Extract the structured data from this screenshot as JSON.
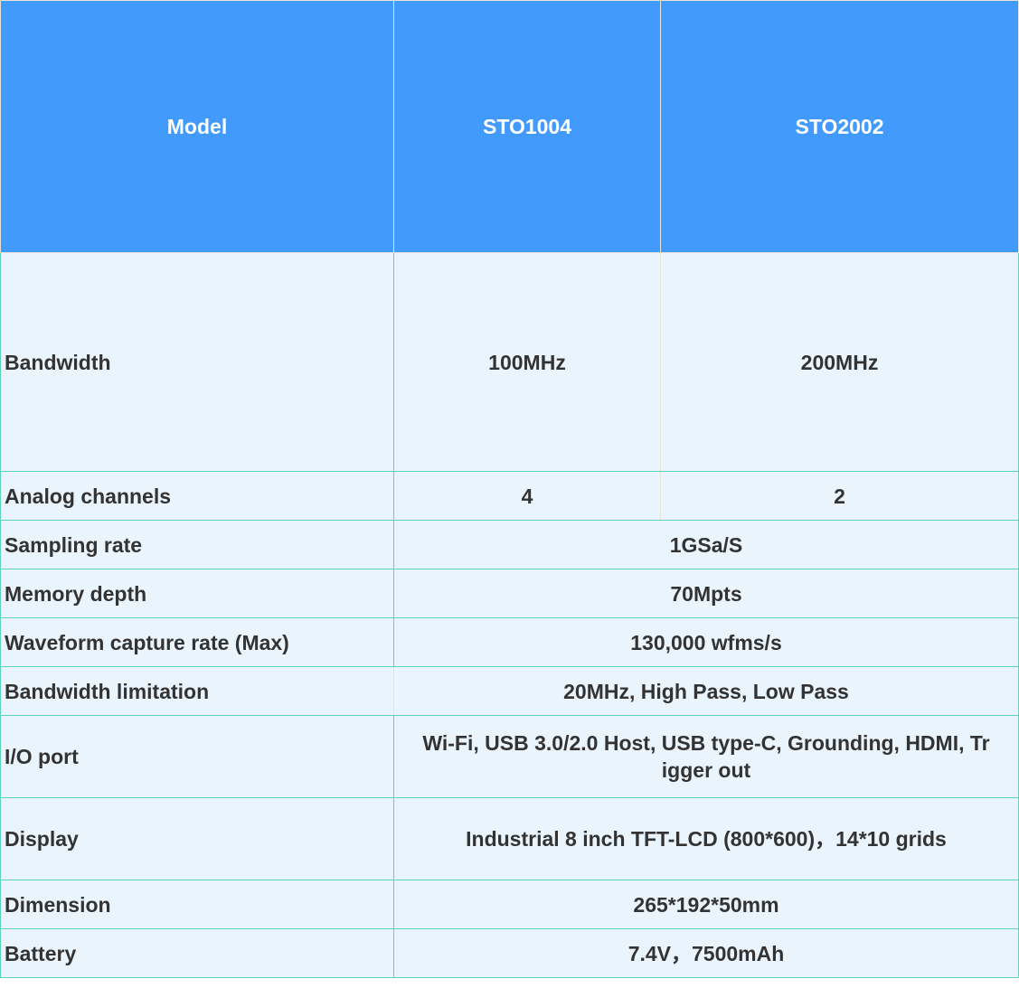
{
  "colors": {
    "header_bg": "#429bfc",
    "header_text": "#ffffff",
    "cell_bg": "#eaf4fd",
    "cell_text": "#333333",
    "border": "#5fd3b8"
  },
  "table": {
    "header": {
      "label": "Model",
      "col1": "STO1004",
      "col2": "STO2002"
    },
    "split_rows": [
      {
        "label": "Bandwidth",
        "col1": "100MHz",
        "col2": "200MHz"
      },
      {
        "label": "Analog channels",
        "col1": "4",
        "col2": "2"
      }
    ],
    "shared_rows": [
      {
        "label": "Sampling rate",
        "value": "1GSa/S"
      },
      {
        "label": "Memory depth",
        "value": "70Mpts"
      },
      {
        "label": "Waveform capture rate (Max)",
        "value": "130,000 wfms/s"
      },
      {
        "label": "Bandwidth limitation",
        "value": "20MHz, High Pass, Low Pass"
      },
      {
        "label": "I/O port",
        "value_line1": "Wi-Fi, USB 3.0/2.0 Host, USB type-C, Grounding, HDMI, Tr",
        "value_line2": "igger out"
      },
      {
        "label": "Display",
        "value": "Industrial 8 inch TFT-LCD (800*600)，14*10 grids"
      },
      {
        "label": "Dimension",
        "value": "265*192*50mm"
      },
      {
        "label": "Battery",
        "value": "7.4V，7500mAh"
      }
    ]
  }
}
